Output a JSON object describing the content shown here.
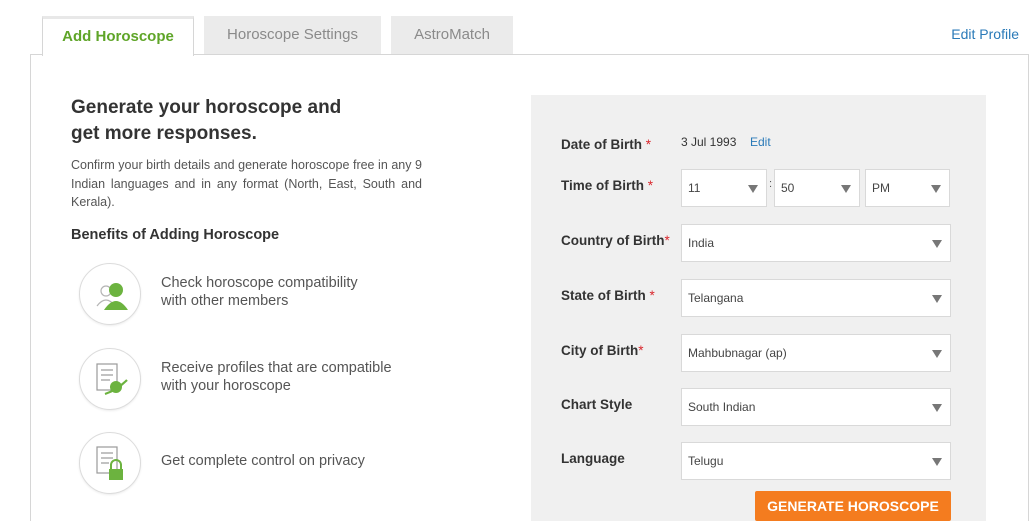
{
  "tabs": {
    "add_horoscope": "Add Horoscope",
    "horoscope_settings": "Horoscope Settings",
    "astromatch": "AstroMatch"
  },
  "edit_profile": "Edit Profile",
  "left": {
    "headline_line1": "Generate your horoscope and",
    "headline_line2": "get more responses.",
    "description": "Confirm your birth details and generate horoscope free in any 9 Indian languages and in any format (North, East, South and Kerala).",
    "benefits_title": "Benefits of Adding Horoscope",
    "benefits": [
      {
        "line1": "Check horoscope compatibility",
        "line2": "with other members",
        "icon": "compatibility-icon"
      },
      {
        "line1": "Receive profiles that are compatible",
        "line2": "with your horoscope",
        "icon": "profile-match-icon"
      },
      {
        "line1": "Get complete control on privacy",
        "line2": "",
        "icon": "privacy-lock-icon"
      }
    ]
  },
  "form": {
    "dob": {
      "label": "Date of Birth",
      "required": "*",
      "value": "3 Jul 1993",
      "edit": "Edit"
    },
    "tob": {
      "label": "Time of Birth",
      "required": "*",
      "hour": "11",
      "minute": "50",
      "ampm": "PM",
      "separator": ":"
    },
    "country": {
      "label": "Country of Birth",
      "required": "*",
      "value": "India"
    },
    "state": {
      "label": "State of Birth",
      "required": "*",
      "value": "Telangana"
    },
    "city": {
      "label": "City of Birth",
      "required": "*",
      "value": "Mahbubnagar (ap)"
    },
    "chart_style": {
      "label": "Chart Style",
      "value": "South Indian"
    },
    "language": {
      "label": "Language",
      "value": "Telugu"
    },
    "generate_button": "GENERATE HOROSCOPE"
  },
  "colors": {
    "accent_green": "#5fa528",
    "link_blue": "#2a7ab8",
    "button_orange": "#f47c1f",
    "required_red": "#d9262c"
  }
}
